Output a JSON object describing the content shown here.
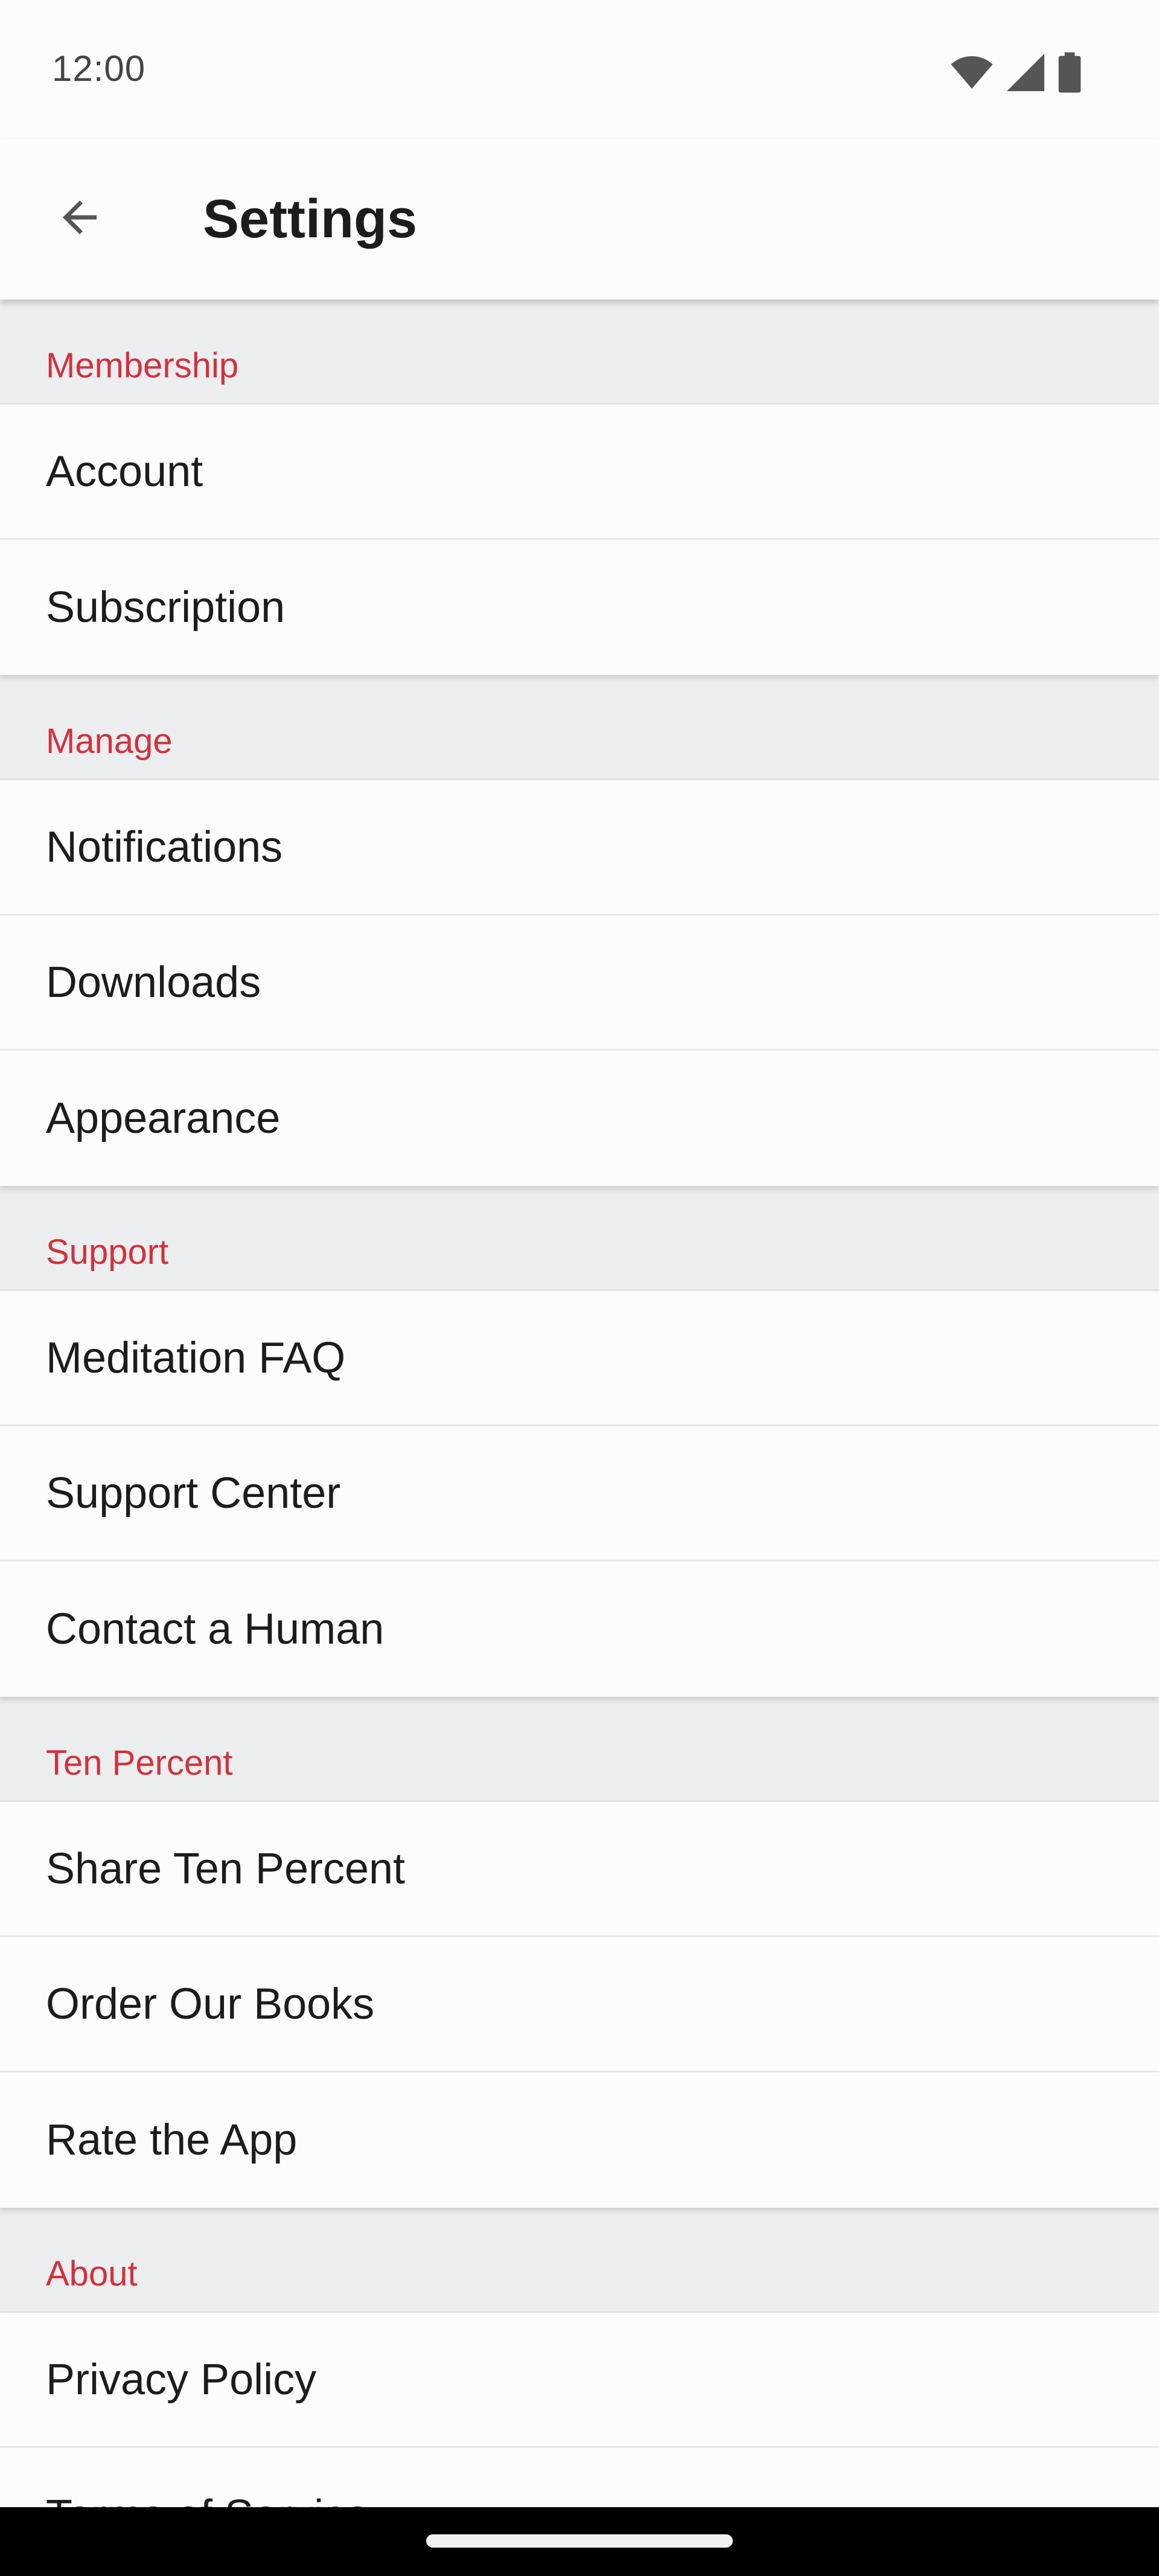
{
  "status_bar": {
    "time": "12:00",
    "icons": [
      "wifi-icon",
      "signal-icon",
      "battery-icon"
    ]
  },
  "app_bar": {
    "back_icon": "arrow-left-icon",
    "title": "Settings"
  },
  "colors": {
    "section_header_text": "#d2323c",
    "section_header_bg": "#eceef0",
    "item_bg": "#fcfcfc",
    "item_text": "#1c1c1e"
  },
  "sections": [
    {
      "title": "Membership",
      "items": [
        "Account",
        "Subscription"
      ]
    },
    {
      "title": "Manage",
      "items": [
        "Notifications",
        "Downloads",
        "Appearance"
      ]
    },
    {
      "title": "Support",
      "items": [
        "Meditation FAQ",
        "Support Center",
        "Contact a Human"
      ]
    },
    {
      "title": "Ten Percent",
      "items": [
        "Share Ten Percent",
        "Order Our Books",
        "Rate the App"
      ]
    },
    {
      "title": "About",
      "items": [
        "Privacy Policy",
        "Terms of Service"
      ]
    }
  ]
}
